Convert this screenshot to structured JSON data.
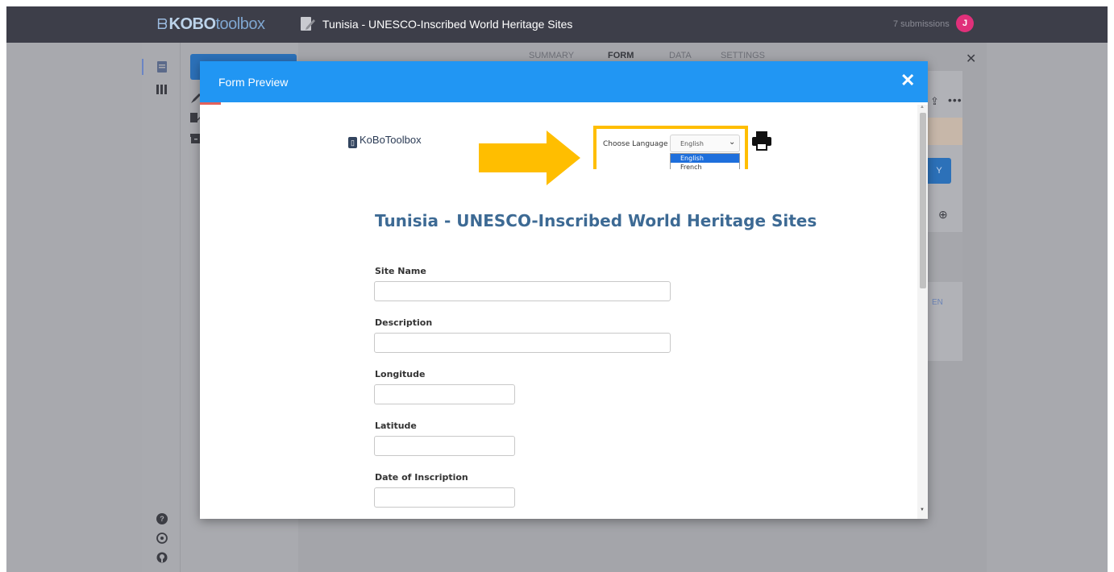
{
  "app": {
    "logo_kobo": "KOBO",
    "logo_toolbox": "toolbox",
    "form_title": "Tunisia - UNESCO-Inscribed World Heritage Sites",
    "submissions": "7 submissions",
    "avatar_initial": "J",
    "brand_color": "#2196f3",
    "accent_color": "#ffbe00"
  },
  "tabs": [
    {
      "label": "SUMMARY",
      "active": false
    },
    {
      "label": "FORM",
      "active": true
    },
    {
      "label": "DATA",
      "active": false
    },
    {
      "label": "SETTINGS",
      "active": false
    }
  ],
  "background_panel": {
    "partial_button_text": "Y",
    "partial_lang_text": "EN"
  },
  "modal": {
    "title": "Form Preview",
    "close_glyph": "✕"
  },
  "preview": {
    "logo_text": "KoBoToolbox",
    "language_label": "Choose Language",
    "language_selected": "English",
    "language_options": [
      "English",
      "French"
    ],
    "form_heading": "Tunisia - UNESCO-Inscribed World Heritage Sites",
    "questions": [
      {
        "label": "Site Name",
        "value": ""
      },
      {
        "label": "Description",
        "value": ""
      },
      {
        "label": "Longitude",
        "value": ""
      },
      {
        "label": "Latitude",
        "value": ""
      },
      {
        "label": "Date of Inscription",
        "value": ""
      }
    ]
  },
  "icons": {
    "sidebar": [
      "form-list-icon",
      "library-icon",
      "deploy-icon",
      "edit-form-icon",
      "archive-icon"
    ],
    "bottom": [
      "help-icon",
      "support-icon",
      "github-icon"
    ],
    "print": "print-icon",
    "annotation": "yellow-arrow"
  }
}
